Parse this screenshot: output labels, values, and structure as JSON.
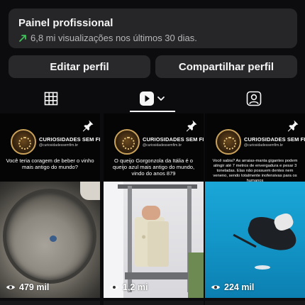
{
  "dashboard": {
    "title": "Painel profissional",
    "stats": "6,8 mi visualizações nos últimos 30 dias.",
    "accent_color": "#3fbf5a",
    "trend_icon": "trend-up-arrow-icon"
  },
  "buttons": {
    "edit": "Editar perfil",
    "share": "Compartilhar perfil"
  },
  "tabs": [
    {
      "name": "grid",
      "icon": "grid-icon",
      "selected": false
    },
    {
      "name": "reels",
      "icon": "reels-play-icon",
      "selected": true
    },
    {
      "name": "tagged",
      "icon": "tagged-person-icon",
      "selected": false
    }
  ],
  "reels": [
    {
      "brand": "CURIOSIDADES SEM FIM",
      "handle": "@curiosidadessemfim.br",
      "caption": "Você teria coragem de beber o vinho mais antigo do mundo?",
      "views": "479 mil",
      "pinned": true
    },
    {
      "brand": "CURIOSIDADES SEM FIM",
      "handle": "@curiosidadessemfim.br",
      "caption": "O queijo Gorgonzola da Itália é o queijo azul mais antigo do mundo, vindo do anos 879",
      "views": "1,2 mi",
      "pinned": true
    },
    {
      "brand": "CURIOSIDADES SEM FIM",
      "handle": "@curiosidadessemfim.br",
      "caption": "Você sabia? As arraias-manta gigantes podem atingir até 7 metros de envergadura e pesar 3 toneladas. Elas não possuem dentes nem veneno, sendo totalmente inofensivas para os humanos",
      "views": "224 mil",
      "pinned": true
    }
  ]
}
